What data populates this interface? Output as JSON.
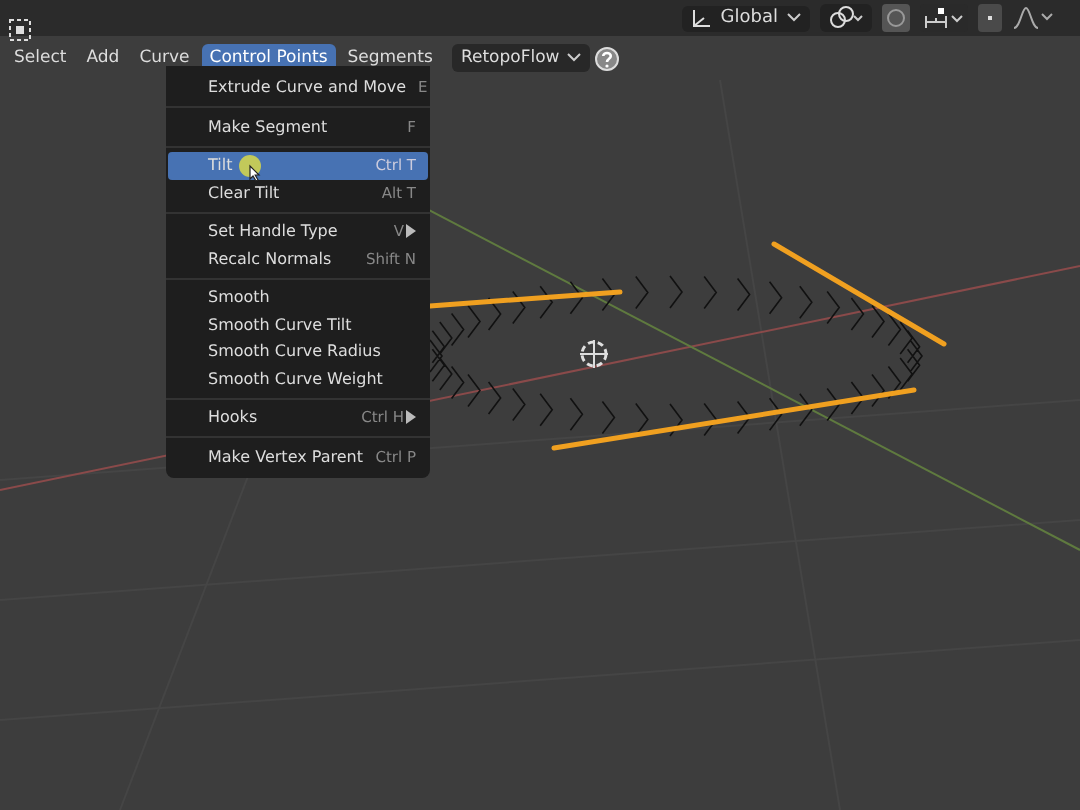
{
  "menubar": {
    "items": [
      {
        "label": "Select",
        "selected": false
      },
      {
        "label": "Add",
        "selected": false
      },
      {
        "label": "Curve",
        "selected": false
      },
      {
        "label": "Control Points",
        "selected": true
      },
      {
        "label": "Segments",
        "selected": false
      }
    ],
    "addon_dropdown": {
      "label": "RetopoFlow"
    }
  },
  "header_right": {
    "orientation": {
      "label": "Global"
    }
  },
  "menu": {
    "items": [
      {
        "kind": "item",
        "label": "Extrude Curve and Move",
        "shortcut": "E",
        "selected": false,
        "submenu": false
      },
      {
        "kind": "separator"
      },
      {
        "kind": "item",
        "label": "Make Segment",
        "shortcut": "F",
        "selected": false,
        "submenu": false
      },
      {
        "kind": "separator"
      },
      {
        "kind": "item",
        "label": "Tilt",
        "shortcut": "Ctrl T",
        "selected": true,
        "submenu": false
      },
      {
        "kind": "item",
        "label": "Clear Tilt",
        "shortcut": "Alt T",
        "selected": false,
        "submenu": false
      },
      {
        "kind": "separator"
      },
      {
        "kind": "item",
        "label": "Set Handle Type",
        "shortcut": "V",
        "selected": false,
        "submenu": true
      },
      {
        "kind": "item",
        "label": "Recalc Normals",
        "shortcut": "Shift N",
        "selected": false,
        "submenu": false
      },
      {
        "kind": "separator"
      },
      {
        "kind": "item",
        "label": "Smooth",
        "selected": false,
        "submenu": false
      },
      {
        "kind": "item",
        "label": "Smooth Curve Tilt",
        "selected": false,
        "submenu": false
      },
      {
        "kind": "item",
        "label": "Smooth Curve Radius",
        "selected": false,
        "submenu": false
      },
      {
        "kind": "item",
        "label": "Smooth Curve Weight",
        "selected": false,
        "submenu": false
      },
      {
        "kind": "separator"
      },
      {
        "kind": "item",
        "label": "Hooks",
        "shortcut": "Ctrl H",
        "selected": false,
        "submenu": true
      },
      {
        "kind": "separator"
      },
      {
        "kind": "item",
        "label": "Make Vertex Parent",
        "shortcut": "Ctrl P",
        "selected": false,
        "submenu": false
      }
    ]
  }
}
